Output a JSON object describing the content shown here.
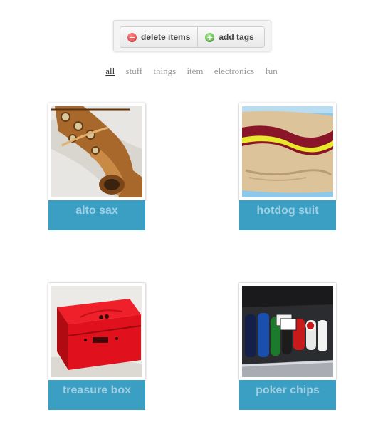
{
  "toolbar": {
    "delete_label": "delete items",
    "add_tags_label": "add tags"
  },
  "filters": [
    "all",
    "stuff",
    "things",
    "item",
    "electronics",
    "fun"
  ],
  "active_filter": "all",
  "items": [
    {
      "title": "alto sax"
    },
    {
      "title": "hotdog suit"
    },
    {
      "title": "treasure box"
    },
    {
      "title": "poker chips"
    }
  ],
  "colors": {
    "caption_bg": "#3a9fc3",
    "caption_text": "#9ecfe2"
  }
}
